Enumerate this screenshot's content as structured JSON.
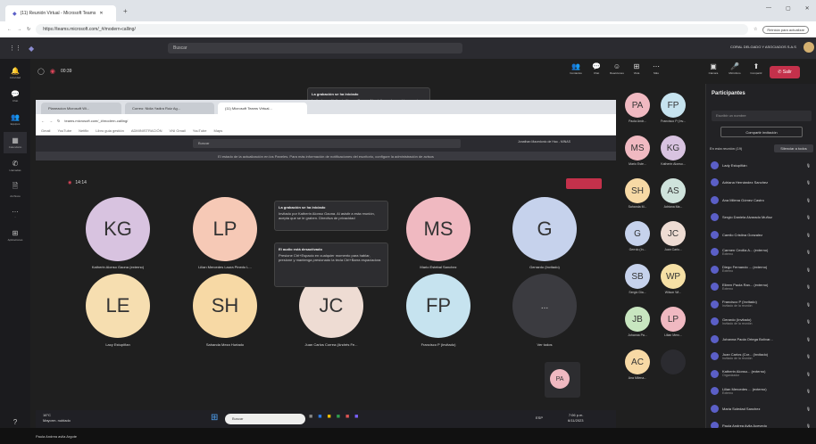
{
  "browser": {
    "tab_title": "(11) Reunión Virtual - Microsoft Teams",
    "url": "https://teams.microsoft.com/_#/modern-calling/",
    "update_label": "Reinicia para actualizar"
  },
  "teams": {
    "search_placeholder": "Buscar",
    "org_name": "CORAL DELGADO Y ASOCIADOS S.A.S",
    "timer": "00:39"
  },
  "rail": {
    "items": [
      {
        "label": "Actividad",
        "icon": "bell-icon"
      },
      {
        "label": "Chat",
        "icon": "chat-icon"
      },
      {
        "label": "Equipos",
        "icon": "teams-icon"
      },
      {
        "label": "Calendario",
        "icon": "calendar-icon"
      },
      {
        "label": "Llamadas",
        "icon": "phone-icon"
      },
      {
        "label": "Archivos",
        "icon": "file-icon"
      },
      {
        "label": "...",
        "icon": "more-icon"
      },
      {
        "label": "Aplicaciones",
        "icon": "apps-icon"
      },
      {
        "label": "Ayuda",
        "icon": "help-icon"
      }
    ]
  },
  "toolbar": {
    "buttons": [
      "Contactos",
      "Chat",
      "Reacciones",
      "Vista",
      "Más",
      "Cámara",
      "Micrófono",
      "Compartir"
    ],
    "leave": "Salir"
  },
  "popup": {
    "title": "La grabación se ha iniciado",
    "text": "Invitado por Katherin Alonso Gaona. Al asistir a esta reunión, acepta que se le graben. Directiva de privacidad"
  },
  "shared": {
    "tabs": [
      "Planeacion Microsoft Wi...",
      "Correo: Nidia Yadira Ruiz Ag...",
      "(11) Microsoft Teams Virtual..."
    ],
    "url": "teams.microsoft.com/_#/modern-calling/",
    "bookmarks": [
      "Gmail",
      "YouTube",
      "Netflix",
      "Libro guia gestión",
      "ADMINISTRACIÓN",
      "VNI Gmail",
      "YouTube",
      "Maps"
    ],
    "teams_search": "Buscar",
    "banner": "El estado de la actualización en los Paneles. Para más información de notificaciones del escritorio, configure la administración de avisos",
    "user": "Jonathan Macedonio de Hao - MINAS",
    "timer": "14:14",
    "popup_title": "La grabación se ha iniciado",
    "popup_text": "Invitado por Katherin Alonso Gaona. Al asistir a esta reunión, acepta que se le graben. Directiva de privacidad",
    "audio_title": "El audio está desactivado",
    "audio_text": "Presione Ctrl+Espacio en cualquier momento para hablar, presione y mantenga presionado la tecla Ctrl+Barra espaciadora",
    "tiles": [
      {
        "initials": "KG",
        "name": "Katherin Alonso Gaona (externo)",
        "color": "#d8c3e0"
      },
      {
        "initials": "LP",
        "name": "Lilian Mercedes Laura Pinedo L...",
        "color": "#f6c9b6"
      },
      {
        "initials": "",
        "name": "",
        "color": ""
      },
      {
        "initials": "MS",
        "name": "Mario Estebal Sanchez",
        "color": "#f0b9c1"
      },
      {
        "initials": "G",
        "name": "Gerrardo (Invitado)",
        "color": "#c6d2ec"
      },
      {
        "initials": "LE",
        "name": "Lacy Estupiñan",
        "color": "#f6deb0"
      },
      {
        "initials": "SH",
        "name": "Sahanda Meza Hurtado",
        "color": "#f7d9a5"
      },
      {
        "initials": "JC",
        "name": "Juan Carlos Correa (Andrés Fe...",
        "color": "#eedcd3"
      },
      {
        "initials": "FP",
        "name": "Francisco P (Invitado)",
        "color": "#c6e3ef"
      },
      {
        "initials": "...",
        "name": "Ver todos",
        "color": "#3b3b40"
      }
    ],
    "small_tile": "PA",
    "taskbar": {
      "weather_temp": "16°C",
      "weather_text": "Mayorm. nublado",
      "search": "Buscar",
      "lang": "ESP",
      "time": "7:06 p.m.",
      "date": "6/11/2023"
    }
  },
  "side_tiles": [
    {
      "initials": "PA",
      "name": "Paola Andr...",
      "color": "#f0b9c1"
    },
    {
      "initials": "FP",
      "name": "Francisco P (Inv...",
      "color": "#c6e3ef"
    },
    {
      "initials": "MS",
      "name": "Mario Este...",
      "color": "#f0b9c1"
    },
    {
      "initials": "KG",
      "name": "Katherin Alonso...",
      "color": "#d8c3e0"
    },
    {
      "initials": "SH",
      "name": "Sahanda M...",
      "color": "#f7d9a5"
    },
    {
      "initials": "AS",
      "name": "Adriana Ma...",
      "color": "#cfe3dc"
    },
    {
      "initials": "G",
      "name": "Gerrdo (In...",
      "color": "#c6d2ec"
    },
    {
      "initials": "JC",
      "name": "Juan Carlo...",
      "color": "#eedcd3"
    },
    {
      "initials": "SB",
      "name": "Sergio Dia...",
      "color": "#c6d2ec"
    },
    {
      "initials": "WP",
      "name": "Wilson Wi...",
      "color": "#f6e0a5"
    },
    {
      "initials": "JB",
      "name": "Johanna Pa...",
      "color": "#c8e6c0"
    },
    {
      "initials": "LP",
      "name": "Lilian Merc...",
      "color": "#f0b9c1"
    },
    {
      "initials": "AC",
      "name": "Ana Milena...",
      "color": "#f7d9a5"
    },
    {
      "initials": "",
      "name": "",
      "color": "#2b2b30"
    }
  ],
  "participants": {
    "title": "Participantes",
    "invite_placeholder": "Escribir un nombre",
    "share_invite": "Compartir invitación",
    "section_label": "En esta reunión (19)",
    "mute_all": "Silenciar a todos",
    "list": [
      {
        "name": "Lady Estupiñán",
        "sub": ""
      },
      {
        "name": "Adriana Hernández Sanchez",
        "sub": ""
      },
      {
        "name": "Ana Milena Gómez Castro",
        "sub": ""
      },
      {
        "name": "Sergio Daniela Alvarado Muñoz",
        "sub": ""
      },
      {
        "name": "Camilo Cristina Gonzalez",
        "sub": ""
      },
      {
        "name": "Carmen Cecilia A... (externo)",
        "sub": "Externo"
      },
      {
        "name": "Diego Fernando ... (externo)",
        "sub": "Externo"
      },
      {
        "name": "Eileen Paola Ran... (externo)",
        "sub": "Externo"
      },
      {
        "name": "Francisco P (Invitado)",
        "sub": "Invitado de la reunión"
      },
      {
        "name": "Gerardo (Invitado)",
        "sub": "Invitado de la reunión"
      },
      {
        "name": "Johanna Paola Ortega Bolívar...",
        "sub": ""
      },
      {
        "name": "Juan Carlos (Cor... (Invitado)",
        "sub": "Invitado de la reunión"
      },
      {
        "name": "Katherin Alonso... (externo)",
        "sub": "Organizador"
      },
      {
        "name": "Lilian Mercedes ... (externo)",
        "sub": "Externo"
      },
      {
        "name": "Maria Soledad Sanchez",
        "sub": ""
      },
      {
        "name": "Paula Andrea Avila Acevedo",
        "sub": ""
      }
    ]
  },
  "bottom_strip": "Paula Andrea avila Argote"
}
